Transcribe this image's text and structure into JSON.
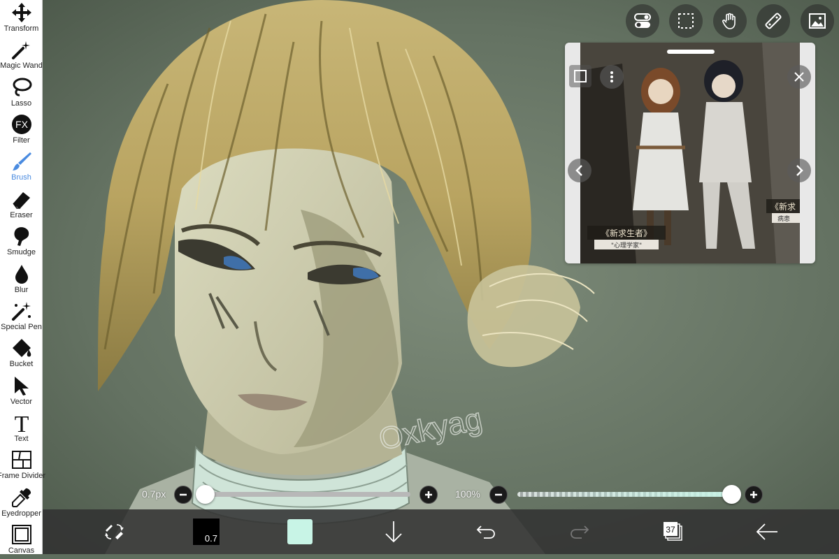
{
  "toolbar": {
    "tools": [
      {
        "label": "Transform",
        "icon": "move-arrows-icon"
      },
      {
        "label": "Magic Wand",
        "icon": "magic-wand-icon"
      },
      {
        "label": "Lasso",
        "icon": "lasso-icon"
      },
      {
        "label": "Filter",
        "icon": "fx-icon"
      },
      {
        "label": "Brush",
        "icon": "brush-icon"
      },
      {
        "label": "Eraser",
        "icon": "eraser-icon"
      },
      {
        "label": "Smudge",
        "icon": "smudge-icon"
      },
      {
        "label": "Blur",
        "icon": "droplet-icon"
      },
      {
        "label": "Special Pen",
        "icon": "sparkle-pen-icon"
      },
      {
        "label": "Bucket",
        "icon": "bucket-icon"
      },
      {
        "label": "Vector",
        "icon": "cursor-arrow-icon"
      },
      {
        "label": "Text",
        "icon": "text-t-icon"
      },
      {
        "label": "Frame Divider",
        "icon": "frame-divider-icon"
      },
      {
        "label": "Eyedropper",
        "icon": "eyedropper-icon"
      },
      {
        "label": "Canvas",
        "icon": "canvas-icon"
      }
    ],
    "active": "Brush",
    "fx_glyph": "FX",
    "text_glyph": "T"
  },
  "top_buttons": [
    "toggle-icon",
    "selection-icon",
    "hand-icon",
    "ruler-icon",
    "reference-image-icon"
  ],
  "brush_size": {
    "label": "0.7px",
    "fraction": 0.0
  },
  "opacity": {
    "label": "100%",
    "fraction": 1.0
  },
  "bottom": {
    "brush_size_badge": "0.7",
    "color_swatch": "#c8f4e6",
    "layer_count": "37"
  },
  "reference": {
    "caption_left": "《新求生者》",
    "sub_left": "\"心理学家\"",
    "caption_right": "《新求",
    "sub_right": "病患"
  },
  "watermark": "Oxkyag",
  "colors": {
    "accent": "#4a8be0",
    "toolbar_bg": "#ffffff",
    "bottom_bg": "#323232"
  }
}
